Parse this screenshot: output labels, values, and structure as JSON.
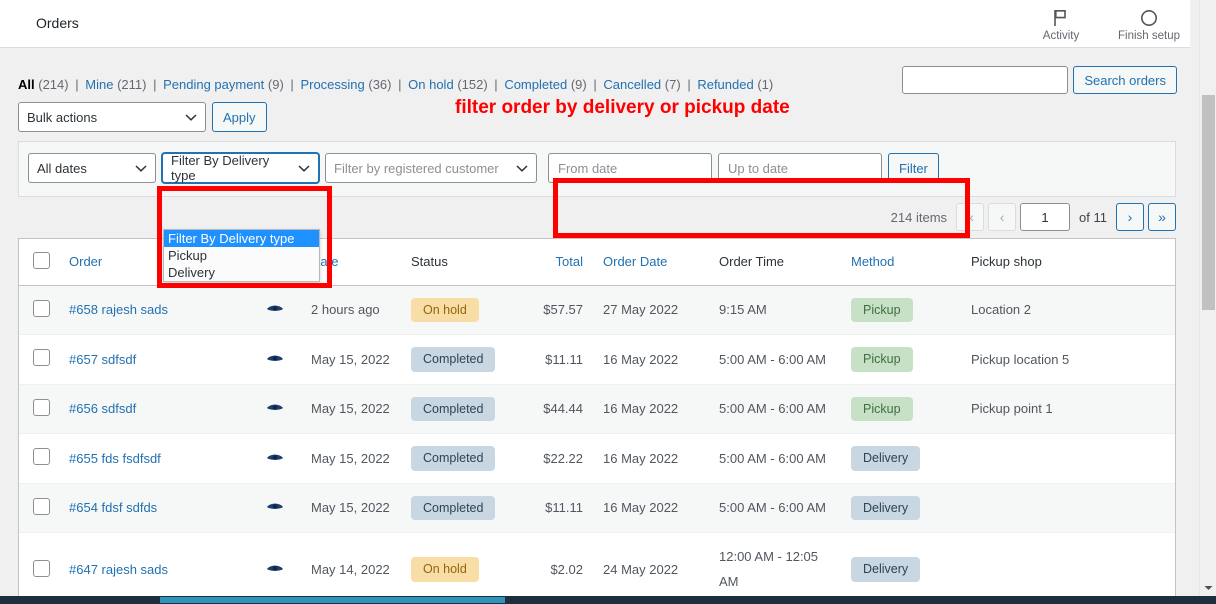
{
  "topbar": {
    "title": "Orders",
    "actions": [
      {
        "icon": "flag-icon",
        "label": "Activity"
      },
      {
        "icon": "circle-icon",
        "label": "Finish setup"
      }
    ]
  },
  "status_filters": {
    "items": [
      {
        "label": "All",
        "count": "(214)",
        "current": true
      },
      {
        "label": "Mine",
        "count": "(211)",
        "current": false
      },
      {
        "label": "Pending payment",
        "count": "(9)",
        "current": false
      },
      {
        "label": "Processing",
        "count": "(36)",
        "current": false
      },
      {
        "label": "On hold",
        "count": "(152)",
        "current": false
      },
      {
        "label": "Completed",
        "count": "(9)",
        "current": false
      },
      {
        "label": "Cancelled",
        "count": "(7)",
        "current": false
      },
      {
        "label": "Refunded",
        "count": "(1)",
        "current": false
      }
    ],
    "separator": "|"
  },
  "search": {
    "value": "",
    "placeholder": "",
    "button_label": "Search orders"
  },
  "bulk": {
    "select_value": "Bulk actions",
    "apply_label": "Apply"
  },
  "annotation": {
    "text": "filter order by delivery or pickup date",
    "color": "#ff0000"
  },
  "filters": {
    "date_select_value": "All dates",
    "delivery_type_select_value": "Filter By Delivery type",
    "customer_select_placeholder": "Filter by registered customer",
    "from_date_placeholder": "From date",
    "from_date_value": "",
    "up_to_date_placeholder": "Up to date",
    "up_to_date_value": "",
    "filter_button_label": "Filter"
  },
  "delivery_dropdown": {
    "open": true,
    "options": [
      {
        "label": "Filter By Delivery type",
        "selected": true
      },
      {
        "label": "Pickup",
        "selected": false
      },
      {
        "label": "Delivery",
        "selected": false
      }
    ],
    "highlight_color": "#1e90ff"
  },
  "pagination": {
    "items_text": "214 items",
    "first_label": "«",
    "prev_label": "‹",
    "current_page": "1",
    "of_text": "of 11",
    "next_label": "›",
    "last_label": "»"
  },
  "table": {
    "columns": [
      {
        "key": "cb",
        "label": "",
        "link": false
      },
      {
        "key": "order",
        "label": "Order",
        "link": true
      },
      {
        "key": "eye",
        "label": "",
        "link": false
      },
      {
        "key": "date",
        "label": "Date",
        "link": true
      },
      {
        "key": "status",
        "label": "Status",
        "link": false
      },
      {
        "key": "total",
        "label": "Total",
        "link": true
      },
      {
        "key": "order_date",
        "label": "Order Date",
        "link": true
      },
      {
        "key": "order_time",
        "label": "Order Time",
        "link": false
      },
      {
        "key": "method",
        "label": "Method",
        "link": true
      },
      {
        "key": "pickup_shop",
        "label": "Pickup shop",
        "link": false
      }
    ],
    "rows": [
      {
        "order": "#658 rajesh sads",
        "date": "2 hours ago",
        "status": "On hold",
        "status_type": "onhold",
        "total": "$57.57",
        "order_date": "27 May 2022",
        "order_time": "9:15 AM",
        "method": "Pickup",
        "method_type": "pickup",
        "pickup_shop": "Location 2"
      },
      {
        "order": "#657 sdfsdf",
        "date": "May 15, 2022",
        "status": "Completed",
        "status_type": "completed",
        "total": "$11.11",
        "order_date": "16 May 2022",
        "order_time": "5:00 AM - 6:00 AM",
        "method": "Pickup",
        "method_type": "pickup",
        "pickup_shop": "Pickup location 5"
      },
      {
        "order": "#656 sdfsdf",
        "date": "May 15, 2022",
        "status": "Completed",
        "status_type": "completed",
        "total": "$44.44",
        "order_date": "16 May 2022",
        "order_time": "5:00 AM - 6:00 AM",
        "method": "Pickup",
        "method_type": "pickup",
        "pickup_shop": "Pickup point 1"
      },
      {
        "order": "#655 fds fsdfsdf",
        "date": "May 15, 2022",
        "status": "Completed",
        "status_type": "completed",
        "total": "$22.22",
        "order_date": "16 May 2022",
        "order_time": "5:00 AM - 6:00 AM",
        "method": "Delivery",
        "method_type": "delivery",
        "pickup_shop": ""
      },
      {
        "order": "#654 fdsf sdfds",
        "date": "May 15, 2022",
        "status": "Completed",
        "status_type": "completed",
        "total": "$11.11",
        "order_date": "16 May 2022",
        "order_time": "5:00 AM - 6:00 AM",
        "method": "Delivery",
        "method_type": "delivery",
        "pickup_shop": ""
      },
      {
        "order": "#647 rajesh sads",
        "date": "May 14, 2022",
        "status": "On hold",
        "status_type": "onhold",
        "total": "$2.02",
        "order_date": "24 May 2022",
        "order_time": "12:00 AM - 12:05 AM",
        "method": "Delivery",
        "method_type": "delivery",
        "pickup_shop": ""
      }
    ]
  }
}
